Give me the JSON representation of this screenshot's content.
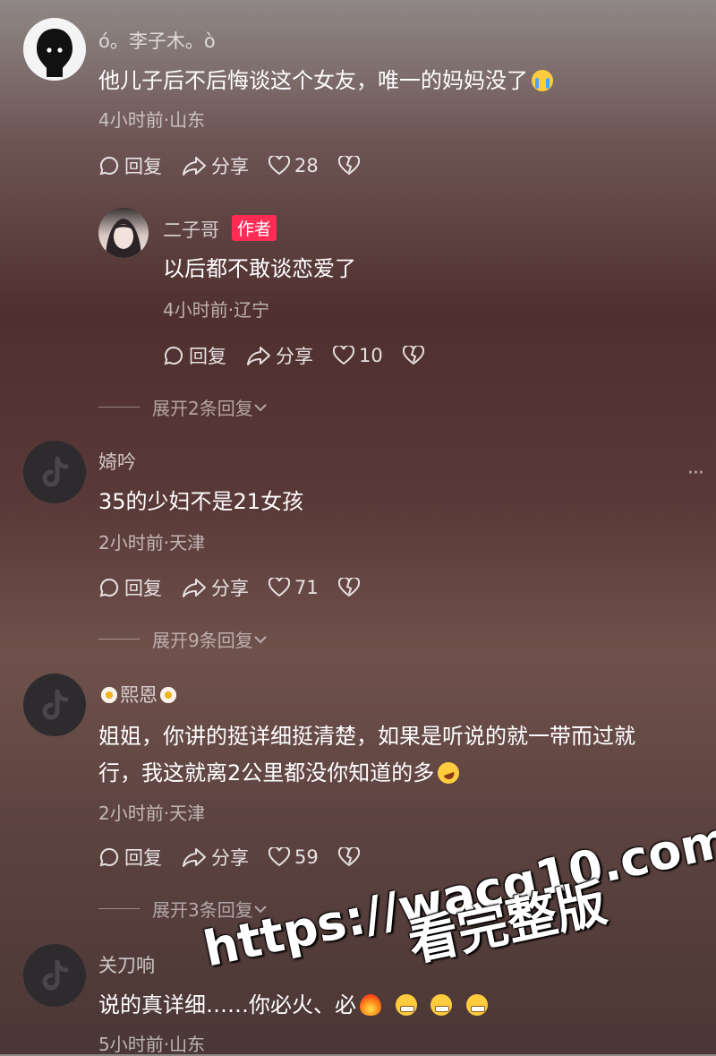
{
  "comments": [
    {
      "username": "ó。李子木。ò",
      "text": "他儿子后不后悔谈这个女友，唯一的妈妈没了",
      "meta": "4小时前·山东",
      "reply_label": "回复",
      "share_label": "分享",
      "likes": "28"
    },
    {
      "username": "二子哥",
      "badge": "作者",
      "text": "以后都不敢谈恋爱了",
      "meta": "4小时前·辽宁",
      "reply_label": "回复",
      "share_label": "分享",
      "likes": "10",
      "expand": "展开2条回复"
    },
    {
      "username": "婍吟",
      "text": "35的少妇不是21女孩",
      "meta": "2小时前·天津",
      "reply_label": "回复",
      "share_label": "分享",
      "likes": "71",
      "expand": "展开9条回复"
    },
    {
      "username": "熙恩",
      "text_line1": "姐姐，你讲的挺详细挺清楚，如果是听说的就一带而过就",
      "text_line2": "行，我这就离2公里都没你知道的多",
      "meta": "2小时前·天津",
      "reply_label": "回复",
      "share_label": "分享",
      "likes": "59",
      "expand": "展开3条回复"
    },
    {
      "username": "关刀响",
      "text": "说的真详细……你必火、必",
      "meta": "5小时前·山东"
    }
  ],
  "more_menu": "···",
  "watermark": {
    "line1": "https://wacg10.com",
    "line2": "看完整版"
  },
  "colors": {
    "author_badge": "#fe2c55",
    "background_dark": "#4f302e"
  },
  "icons": [
    "comment-bubble-icon",
    "share-arrow-icon",
    "heart-icon",
    "broken-heart-icon",
    "tiktok-logo-icon"
  ]
}
